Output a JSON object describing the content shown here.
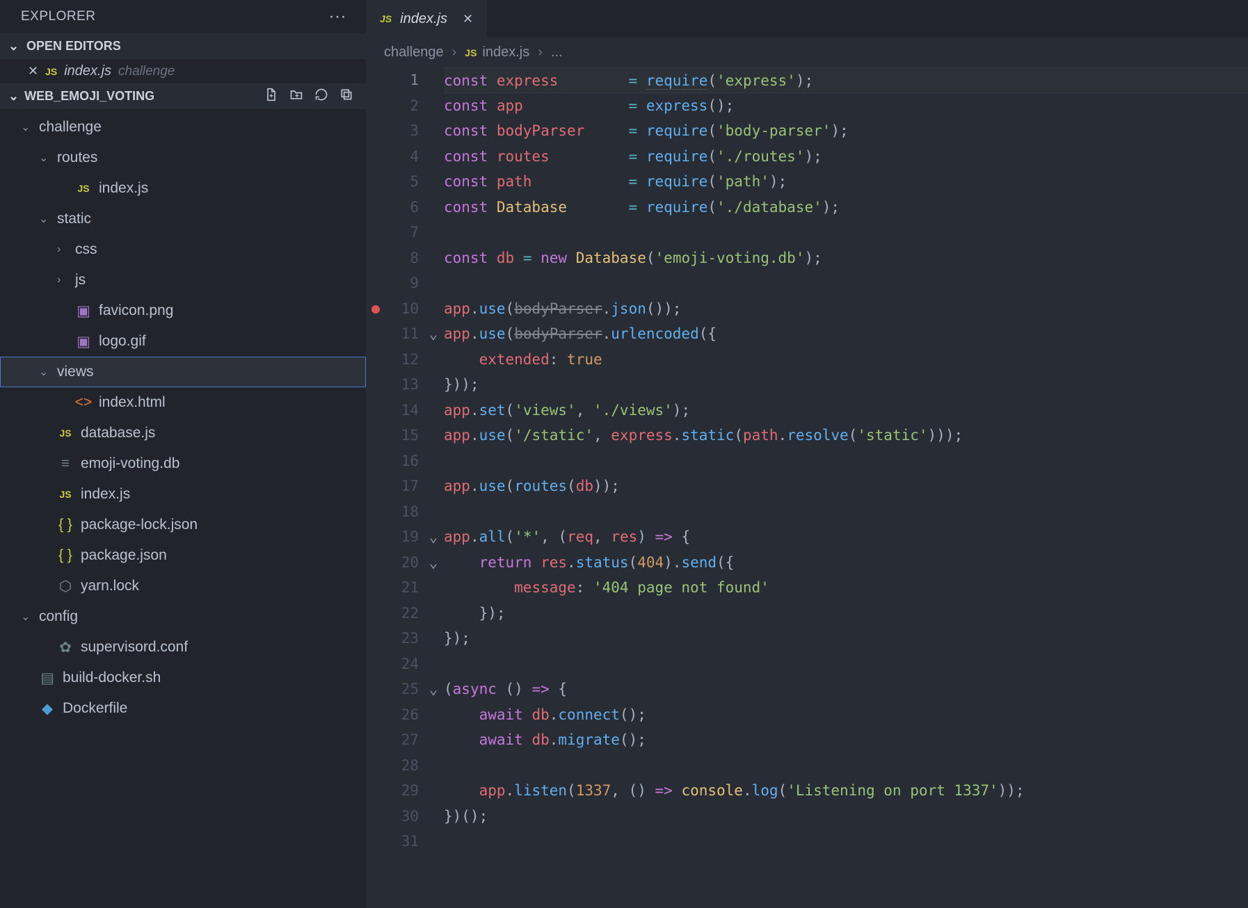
{
  "explorer": {
    "title": "EXPLORER",
    "open_editors_label": "OPEN EDITORS",
    "open_editor": {
      "filename": "index.js",
      "folder": "challenge"
    },
    "workspace_name": "WEB_EMOJI_VOTING",
    "tree": [
      {
        "label": "challenge",
        "type": "folder",
        "open": true,
        "indent": 0
      },
      {
        "label": "routes",
        "type": "folder",
        "open": true,
        "indent": 1
      },
      {
        "label": "index.js",
        "type": "js",
        "indent": 2
      },
      {
        "label": "static",
        "type": "folder",
        "open": true,
        "indent": 1
      },
      {
        "label": "css",
        "type": "folder",
        "open": false,
        "indent": 2
      },
      {
        "label": "js",
        "type": "folder",
        "open": false,
        "indent": 2
      },
      {
        "label": "favicon.png",
        "type": "image",
        "indent": 2
      },
      {
        "label": "logo.gif",
        "type": "image",
        "indent": 2
      },
      {
        "label": "views",
        "type": "folder",
        "open": true,
        "indent": 1,
        "selected": true
      },
      {
        "label": "index.html",
        "type": "html",
        "indent": 2
      },
      {
        "label": "database.js",
        "type": "js",
        "indent": 1
      },
      {
        "label": "emoji-voting.db",
        "type": "db",
        "indent": 1
      },
      {
        "label": "index.js",
        "type": "js",
        "indent": 1
      },
      {
        "label": "package-lock.json",
        "type": "json",
        "indent": 1
      },
      {
        "label": "package.json",
        "type": "json",
        "indent": 1
      },
      {
        "label": "yarn.lock",
        "type": "lock",
        "indent": 1
      },
      {
        "label": "config",
        "type": "folder",
        "open": true,
        "indent": 0
      },
      {
        "label": "supervisord.conf",
        "type": "gear",
        "indent": 1
      },
      {
        "label": "build-docker.sh",
        "type": "sh",
        "indent": 0
      },
      {
        "label": "Dockerfile",
        "type": "docker",
        "indent": 0
      }
    ]
  },
  "tabs": {
    "active": {
      "filename": "index.js"
    }
  },
  "breadcrumbs": {
    "folder": "challenge",
    "file": "index.js",
    "trail": "..."
  },
  "code": {
    "lines": [
      [
        [
          "kw",
          "const "
        ],
        [
          "var",
          "express"
        ],
        [
          "plain",
          "        "
        ],
        [
          "op",
          "="
        ],
        [
          "plain",
          " "
        ],
        [
          "fn",
          "require"
        ],
        [
          "pn",
          "("
        ],
        [
          "str",
          "'express'"
        ],
        [
          "pn",
          ");"
        ]
      ],
      [
        [
          "kw",
          "const "
        ],
        [
          "var",
          "app"
        ],
        [
          "plain",
          "            "
        ],
        [
          "op",
          "="
        ],
        [
          "plain",
          " "
        ],
        [
          "fn",
          "express"
        ],
        [
          "pn",
          "();"
        ]
      ],
      [
        [
          "kw",
          "const "
        ],
        [
          "var",
          "bodyParser"
        ],
        [
          "plain",
          "     "
        ],
        [
          "op",
          "="
        ],
        [
          "plain",
          " "
        ],
        [
          "fn",
          "require"
        ],
        [
          "pn",
          "("
        ],
        [
          "str",
          "'body-parser'"
        ],
        [
          "pn",
          ");"
        ]
      ],
      [
        [
          "kw",
          "const "
        ],
        [
          "var",
          "routes"
        ],
        [
          "plain",
          "         "
        ],
        [
          "op",
          "="
        ],
        [
          "plain",
          " "
        ],
        [
          "fn",
          "require"
        ],
        [
          "pn",
          "("
        ],
        [
          "str",
          "'./routes'"
        ],
        [
          "pn",
          ");"
        ]
      ],
      [
        [
          "kw",
          "const "
        ],
        [
          "var",
          "path"
        ],
        [
          "plain",
          "           "
        ],
        [
          "op",
          "="
        ],
        [
          "plain",
          " "
        ],
        [
          "fn",
          "require"
        ],
        [
          "pn",
          "("
        ],
        [
          "str",
          "'path'"
        ],
        [
          "pn",
          ");"
        ]
      ],
      [
        [
          "kw",
          "const "
        ],
        [
          "cls",
          "Database"
        ],
        [
          "plain",
          "       "
        ],
        [
          "op",
          "="
        ],
        [
          "plain",
          " "
        ],
        [
          "fn",
          "require"
        ],
        [
          "pn",
          "("
        ],
        [
          "str",
          "'./database'"
        ],
        [
          "pn",
          ");"
        ]
      ],
      [],
      [
        [
          "kw",
          "const "
        ],
        [
          "var",
          "db"
        ],
        [
          "plain",
          " "
        ],
        [
          "op",
          "="
        ],
        [
          "plain",
          " "
        ],
        [
          "kw",
          "new"
        ],
        [
          "plain",
          " "
        ],
        [
          "cls",
          "Database"
        ],
        [
          "pn",
          "("
        ],
        [
          "str",
          "'emoji-voting.db'"
        ],
        [
          "pn",
          ");"
        ]
      ],
      [],
      [
        [
          "var",
          "app"
        ],
        [
          "pn",
          "."
        ],
        [
          "fn",
          "use"
        ],
        [
          "pn",
          "("
        ],
        [
          "dep",
          "bodyParser"
        ],
        [
          "pn",
          "."
        ],
        [
          "fn",
          "json"
        ],
        [
          "pn",
          "());"
        ]
      ],
      [
        [
          "var",
          "app"
        ],
        [
          "pn",
          "."
        ],
        [
          "fn",
          "use"
        ],
        [
          "pn",
          "("
        ],
        [
          "dep",
          "bodyParser"
        ],
        [
          "pn",
          "."
        ],
        [
          "fn",
          "urlencoded"
        ],
        [
          "pn",
          "({"
        ]
      ],
      [
        [
          "plain",
          "    "
        ],
        [
          "prop",
          "extended"
        ],
        [
          "pn",
          ":"
        ],
        [
          "plain",
          " "
        ],
        [
          "const",
          "true"
        ]
      ],
      [
        [
          "pn",
          "}));"
        ]
      ],
      [
        [
          "var",
          "app"
        ],
        [
          "pn",
          "."
        ],
        [
          "fn",
          "set"
        ],
        [
          "pn",
          "("
        ],
        [
          "str",
          "'views'"
        ],
        [
          "pn",
          ", "
        ],
        [
          "str",
          "'./views'"
        ],
        [
          "pn",
          ");"
        ]
      ],
      [
        [
          "var",
          "app"
        ],
        [
          "pn",
          "."
        ],
        [
          "fn",
          "use"
        ],
        [
          "pn",
          "("
        ],
        [
          "str",
          "'/static'"
        ],
        [
          "pn",
          ", "
        ],
        [
          "var",
          "express"
        ],
        [
          "pn",
          "."
        ],
        [
          "fn",
          "static"
        ],
        [
          "pn",
          "("
        ],
        [
          "var",
          "path"
        ],
        [
          "pn",
          "."
        ],
        [
          "fn",
          "resolve"
        ],
        [
          "pn",
          "("
        ],
        [
          "str",
          "'static'"
        ],
        [
          "pn",
          ")));"
        ]
      ],
      [],
      [
        [
          "var",
          "app"
        ],
        [
          "pn",
          "."
        ],
        [
          "fn",
          "use"
        ],
        [
          "pn",
          "("
        ],
        [
          "fn",
          "routes"
        ],
        [
          "pn",
          "("
        ],
        [
          "var",
          "db"
        ],
        [
          "pn",
          "));"
        ]
      ],
      [],
      [
        [
          "var",
          "app"
        ],
        [
          "pn",
          "."
        ],
        [
          "fn",
          "all"
        ],
        [
          "pn",
          "("
        ],
        [
          "str",
          "'*'"
        ],
        [
          "pn",
          ", ("
        ],
        [
          "var",
          "req"
        ],
        [
          "pn",
          ", "
        ],
        [
          "var",
          "res"
        ],
        [
          "pn",
          ") "
        ],
        [
          "kw",
          "=>"
        ],
        [
          "pn",
          " {"
        ]
      ],
      [
        [
          "plain",
          "    "
        ],
        [
          "kw",
          "return"
        ],
        [
          "plain",
          " "
        ],
        [
          "var",
          "res"
        ],
        [
          "pn",
          "."
        ],
        [
          "fn",
          "status"
        ],
        [
          "pn",
          "("
        ],
        [
          "num",
          "404"
        ],
        [
          "pn",
          ")."
        ],
        [
          "fn",
          "send"
        ],
        [
          "pn",
          "({"
        ]
      ],
      [
        [
          "plain",
          "        "
        ],
        [
          "prop",
          "message"
        ],
        [
          "pn",
          ":"
        ],
        [
          "plain",
          " "
        ],
        [
          "str",
          "'404 page not found'"
        ]
      ],
      [
        [
          "plain",
          "    "
        ],
        [
          "pn",
          "});"
        ]
      ],
      [
        [
          "pn",
          "});"
        ]
      ],
      [],
      [
        [
          "pn",
          "("
        ],
        [
          "kw",
          "async"
        ],
        [
          "pn",
          " () "
        ],
        [
          "kw",
          "=>"
        ],
        [
          "pn",
          " {"
        ]
      ],
      [
        [
          "plain",
          "    "
        ],
        [
          "kw",
          "await"
        ],
        [
          "plain",
          " "
        ],
        [
          "var",
          "db"
        ],
        [
          "pn",
          "."
        ],
        [
          "fn",
          "connect"
        ],
        [
          "pn",
          "();"
        ]
      ],
      [
        [
          "plain",
          "    "
        ],
        [
          "kw",
          "await"
        ],
        [
          "plain",
          " "
        ],
        [
          "var",
          "db"
        ],
        [
          "pn",
          "."
        ],
        [
          "fn",
          "migrate"
        ],
        [
          "pn",
          "();"
        ]
      ],
      [],
      [
        [
          "plain",
          "    "
        ],
        [
          "var",
          "app"
        ],
        [
          "pn",
          "."
        ],
        [
          "fn",
          "listen"
        ],
        [
          "pn",
          "("
        ],
        [
          "num",
          "1337"
        ],
        [
          "pn",
          ", () "
        ],
        [
          "kw",
          "=>"
        ],
        [
          "plain",
          " "
        ],
        [
          "cls",
          "console"
        ],
        [
          "pn",
          "."
        ],
        [
          "fn",
          "log"
        ],
        [
          "pn",
          "("
        ],
        [
          "str",
          "'Listening on port 1337'"
        ],
        [
          "pn",
          "));"
        ]
      ],
      [
        [
          "pn",
          "})();"
        ]
      ],
      []
    ],
    "breakpoints": [
      10
    ],
    "fold_markers": {
      "11": "open",
      "19": "open",
      "20": "open",
      "25": "open"
    },
    "current_line": 1
  }
}
